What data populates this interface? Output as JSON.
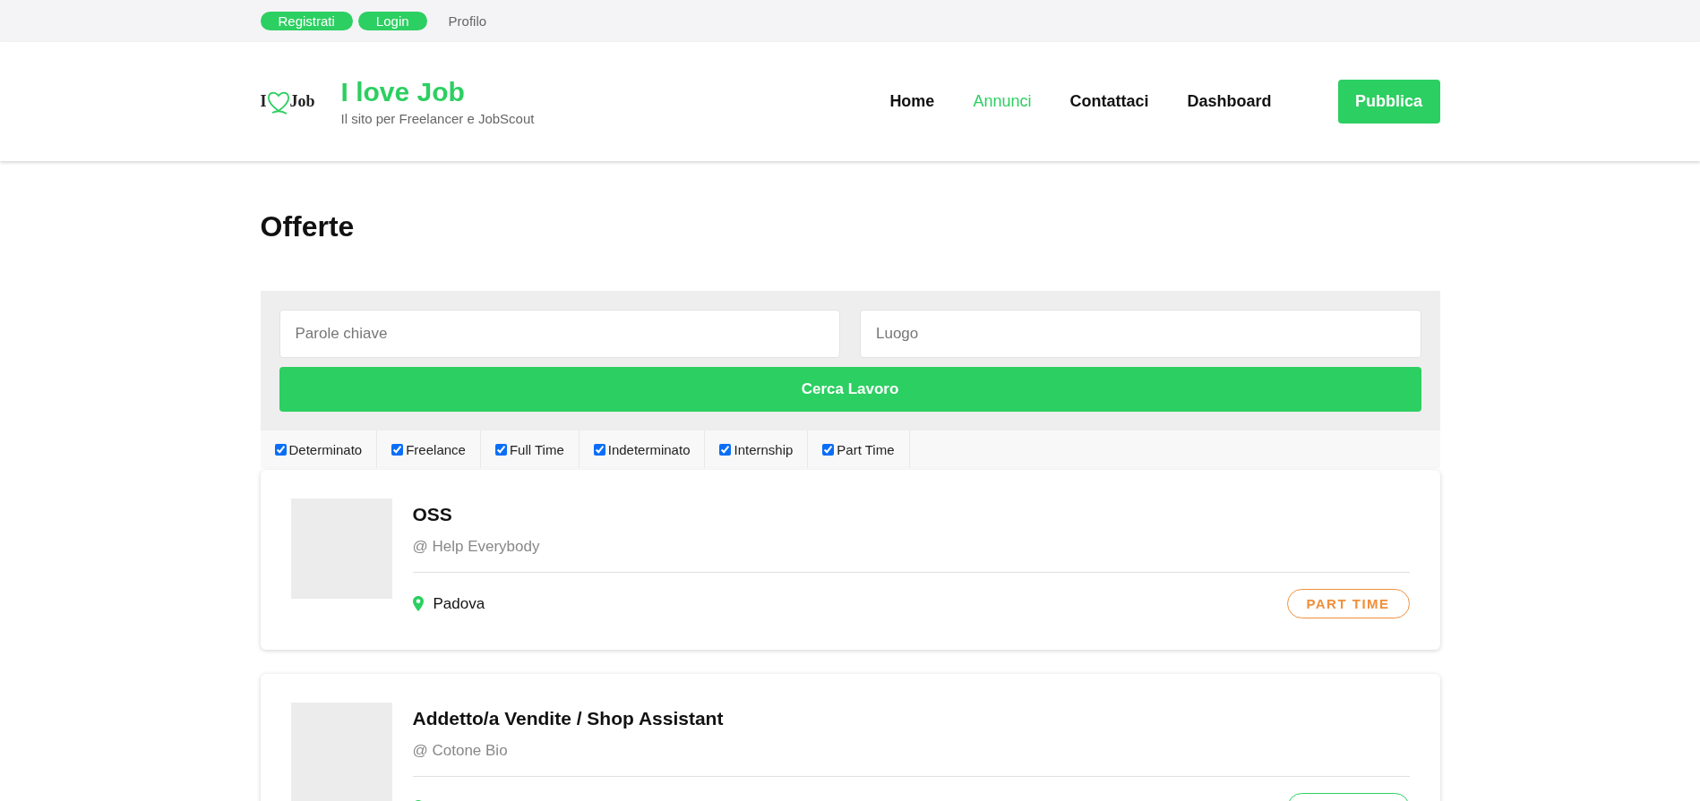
{
  "top_bar": {
    "links": [
      {
        "label": "Registrati",
        "kind": "pill"
      },
      {
        "label": "Login",
        "kind": "pill"
      },
      {
        "label": "Profilo",
        "kind": "plain"
      }
    ]
  },
  "header": {
    "logo": {
      "before": "I",
      "after": "Job"
    },
    "site_title": "I love Job",
    "tagline": "Il sito per Freelancer e JobScout",
    "nav": [
      {
        "label": "Home",
        "selected": false
      },
      {
        "label": "Annunci",
        "selected": true
      },
      {
        "label": "Contattaci",
        "selected": false
      },
      {
        "label": "Dashboard",
        "selected": false
      }
    ],
    "publish_button": "Pubblica"
  },
  "page_title": "Offerte",
  "search": {
    "keywords_placeholder": "Parole chiave",
    "location_placeholder": "Luogo",
    "button": "Cerca Lavoro"
  },
  "filters": [
    {
      "label": "Determinato",
      "checked": true
    },
    {
      "label": "Freelance",
      "checked": true
    },
    {
      "label": "Full Time",
      "checked": true
    },
    {
      "label": "Indeterminato",
      "checked": true
    },
    {
      "label": "Internship",
      "checked": true
    },
    {
      "label": "Part Time",
      "checked": true
    }
  ],
  "jobs": [
    {
      "title": "OSS",
      "company": "@ Help Everybody",
      "location": "Padova",
      "tag": "PART TIME",
      "color": "#f0903c"
    },
    {
      "title": "Addetto/a Vendite / Shop Assistant",
      "company": "@ Cotone Bio",
      "color": "#2ccf61"
    }
  ]
}
